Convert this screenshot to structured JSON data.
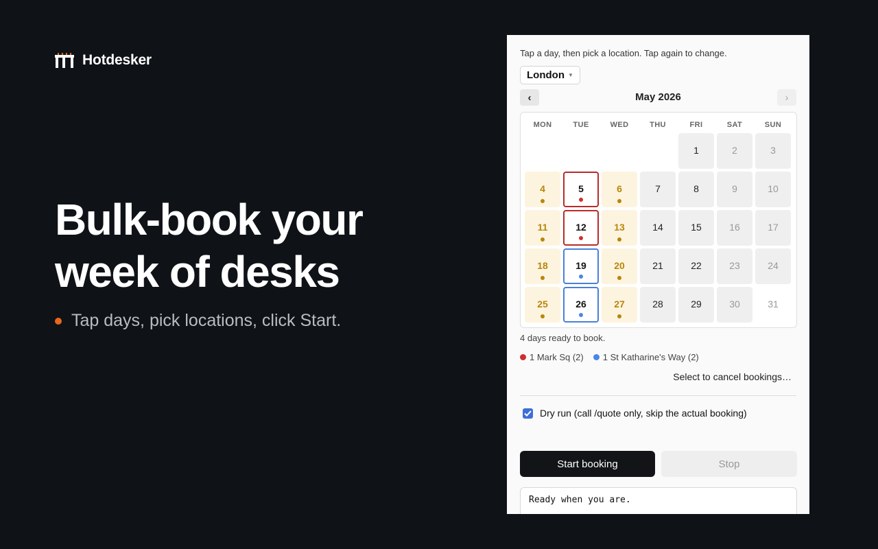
{
  "brand": {
    "name": "Hotdesker"
  },
  "promo": {
    "headline_line1": "Bulk-book your",
    "headline_line2": "week of desks",
    "bullet": "Tap days, pick locations, click Start.",
    "bullet_color": "#e8671c"
  },
  "panel": {
    "hint": "Tap a day, then pick a location. Tap again to change.",
    "location": "London",
    "prev_label": "‹",
    "next_label": "›",
    "month_label": "May 2026",
    "weekdays": [
      "MON",
      "TUE",
      "WED",
      "THU",
      "FRI",
      "SAT",
      "SUN"
    ],
    "days": [
      {
        "d": "1",
        "week": 0,
        "col": 4,
        "state": "weekday"
      },
      {
        "d": "2",
        "week": 0,
        "col": 5,
        "state": "weekend"
      },
      {
        "d": "3",
        "week": 0,
        "col": 6,
        "state": "weekend"
      },
      {
        "d": "4",
        "week": 1,
        "col": 0,
        "state": "mon"
      },
      {
        "d": "5",
        "week": 1,
        "col": 1,
        "state": "red"
      },
      {
        "d": "6",
        "week": 1,
        "col": 2,
        "state": "mon"
      },
      {
        "d": "7",
        "week": 1,
        "col": 3,
        "state": "weekday"
      },
      {
        "d": "8",
        "week": 1,
        "col": 4,
        "state": "weekday"
      },
      {
        "d": "9",
        "week": 1,
        "col": 5,
        "state": "weekend"
      },
      {
        "d": "10",
        "week": 1,
        "col": 6,
        "state": "weekend"
      },
      {
        "d": "11",
        "week": 2,
        "col": 0,
        "state": "mon"
      },
      {
        "d": "12",
        "week": 2,
        "col": 1,
        "state": "red"
      },
      {
        "d": "13",
        "week": 2,
        "col": 2,
        "state": "mon"
      },
      {
        "d": "14",
        "week": 2,
        "col": 3,
        "state": "weekday"
      },
      {
        "d": "15",
        "week": 2,
        "col": 4,
        "state": "weekday"
      },
      {
        "d": "16",
        "week": 2,
        "col": 5,
        "state": "weekend"
      },
      {
        "d": "17",
        "week": 2,
        "col": 6,
        "state": "weekend"
      },
      {
        "d": "18",
        "week": 3,
        "col": 0,
        "state": "mon"
      },
      {
        "d": "19",
        "week": 3,
        "col": 1,
        "state": "blue"
      },
      {
        "d": "20",
        "week": 3,
        "col": 2,
        "state": "mon"
      },
      {
        "d": "21",
        "week": 3,
        "col": 3,
        "state": "weekday"
      },
      {
        "d": "22",
        "week": 3,
        "col": 4,
        "state": "weekday"
      },
      {
        "d": "23",
        "week": 3,
        "col": 5,
        "state": "weekend"
      },
      {
        "d": "24",
        "week": 3,
        "col": 6,
        "state": "weekend"
      },
      {
        "d": "25",
        "week": 4,
        "col": 0,
        "state": "mon"
      },
      {
        "d": "26",
        "week": 4,
        "col": 1,
        "state": "blue"
      },
      {
        "d": "27",
        "week": 4,
        "col": 2,
        "state": "mon"
      },
      {
        "d": "28",
        "week": 4,
        "col": 3,
        "state": "weekday"
      },
      {
        "d": "29",
        "week": 4,
        "col": 4,
        "state": "weekday"
      },
      {
        "d": "30",
        "week": 4,
        "col": 5,
        "state": "weekend"
      },
      {
        "d": "31",
        "week": 4,
        "col": 6,
        "state": "weekend-last"
      }
    ],
    "ready_text": "4 days ready to book.",
    "legend": [
      {
        "label": "1 Mark Sq (2)",
        "color": "#d12e2e"
      },
      {
        "label": "1 St Katharine's Way (2)",
        "color": "#4a86e8"
      }
    ],
    "cancel_link": "Select to cancel bookings…",
    "dry_run_label": "Dry run (call /quote only, skip the actual booking)",
    "dry_run_checked": true,
    "start_label": "Start booking",
    "stop_label": "Stop",
    "log_text": "Ready when you are."
  },
  "colors": {
    "mon_dot": "#b8860b",
    "red": "#d12e2e",
    "blue": "#4a86e8",
    "checkbox": "#3d6fd8"
  }
}
